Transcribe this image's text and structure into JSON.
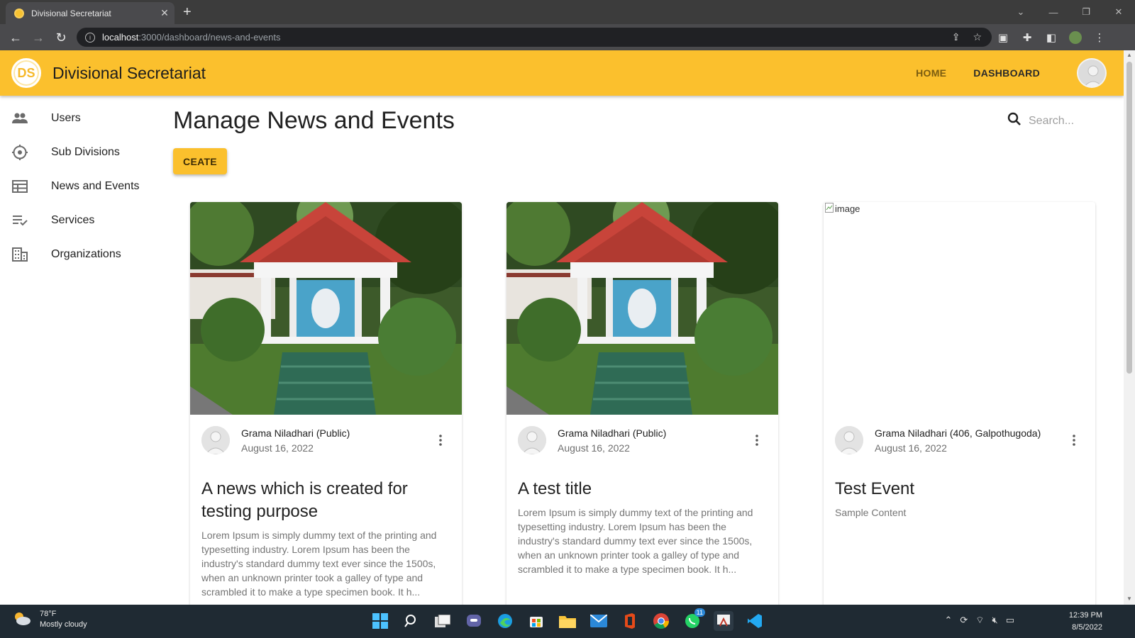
{
  "browser": {
    "tab_title": "Divisional Secretariat",
    "url_host": "localhost",
    "url_path": ":3000/dashboard/news-and-events"
  },
  "app": {
    "logo_text": "DS",
    "title": "Divisional Secretariat",
    "nav": {
      "home": "HOME",
      "dashboard": "DASHBOARD"
    },
    "accent_color": "#fbc02d"
  },
  "sidebar": {
    "items": [
      {
        "label": "Users",
        "icon": "people-icon"
      },
      {
        "label": "Sub Divisions",
        "icon": "location-icon"
      },
      {
        "label": "News and Events",
        "icon": "calendar-view-icon"
      },
      {
        "label": "Services",
        "icon": "playlist-check-icon"
      },
      {
        "label": "Organizations",
        "icon": "building-icon"
      }
    ]
  },
  "main": {
    "page_title": "Manage News and Events",
    "create_label": "CEATE",
    "search_placeholder": "Search..."
  },
  "cards": [
    {
      "author": "Grama Niladhari (Public)",
      "date": "August 16, 2022",
      "title": "A news which is created for testing purpose",
      "body": "Lorem Ipsum is simply dummy text of the printing and typesetting industry. Lorem Ipsum has been the industry's standard dummy text ever since the 1500s, when an unknown printer took a galley of type and scrambled it to make a type specimen book. It h...",
      "image": "shrine-photo"
    },
    {
      "author": "Grama Niladhari (Public)",
      "date": "August 16, 2022",
      "title": "A test title",
      "body": "Lorem Ipsum is simply dummy text of the printing and typesetting industry. Lorem Ipsum has been the industry's standard dummy text ever since the 1500s, when an unknown printer took a galley of type and scrambled it to make a type specimen book. It h...",
      "image": "shrine-photo"
    },
    {
      "author": "Grama Niladhari (406, Galpothugoda)",
      "date": "August 16, 2022",
      "title": "Test Event",
      "body": "Sample Content",
      "image": "broken-image",
      "image_alt": "image"
    }
  ],
  "taskbar": {
    "temperature": "78°F",
    "weather": "Mostly cloudy",
    "time": "12:39 PM",
    "date": "8/5/2022",
    "whatsapp_badge": "11"
  }
}
